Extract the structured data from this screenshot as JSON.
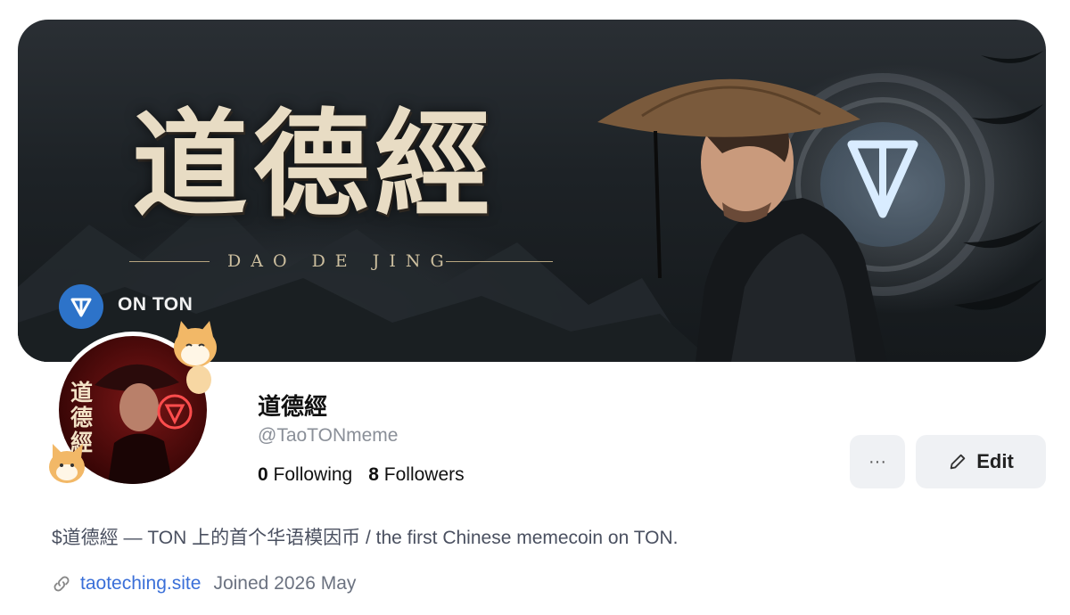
{
  "banner": {
    "title": "道德經",
    "subtitle": "DAO DE JING",
    "badge_label": "ON TON"
  },
  "avatar": {
    "chars": "道德經"
  },
  "profile": {
    "display_name": "道德經",
    "handle": "@TaoTONmeme",
    "following_count": "0",
    "following_label": "Following",
    "followers_count": "8",
    "followers_label": "Followers",
    "bio": "$道德經 — TON 上的首个华语模因币 / the first Chinese memecoin on TON.",
    "website": "taoteching.site",
    "joined": "Joined 2026 May"
  },
  "actions": {
    "more_label": "···",
    "edit_label": "Edit"
  },
  "colors": {
    "ton_blue": "#2d73c9",
    "link": "#3a6fd8",
    "button_bg": "#eff1f4"
  }
}
